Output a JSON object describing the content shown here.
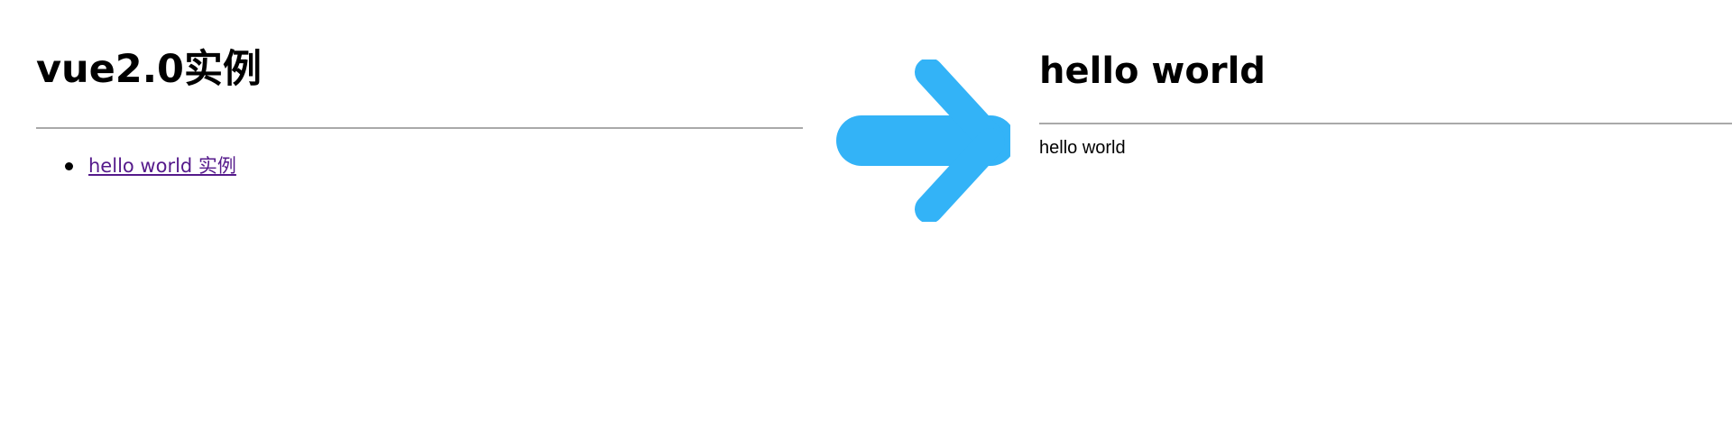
{
  "left_page": {
    "title": "vue2.0实例",
    "examples": [
      {
        "label": "hello world 实例"
      }
    ]
  },
  "right_page": {
    "title": "hello world",
    "output": "hello world"
  },
  "transition_arrow": {
    "icon": "arrow-right-icon",
    "color": "#33b3f7"
  },
  "colors": {
    "visited_link": "#551a8b",
    "rule": "#a9a9a9",
    "background": "#ffffff"
  }
}
